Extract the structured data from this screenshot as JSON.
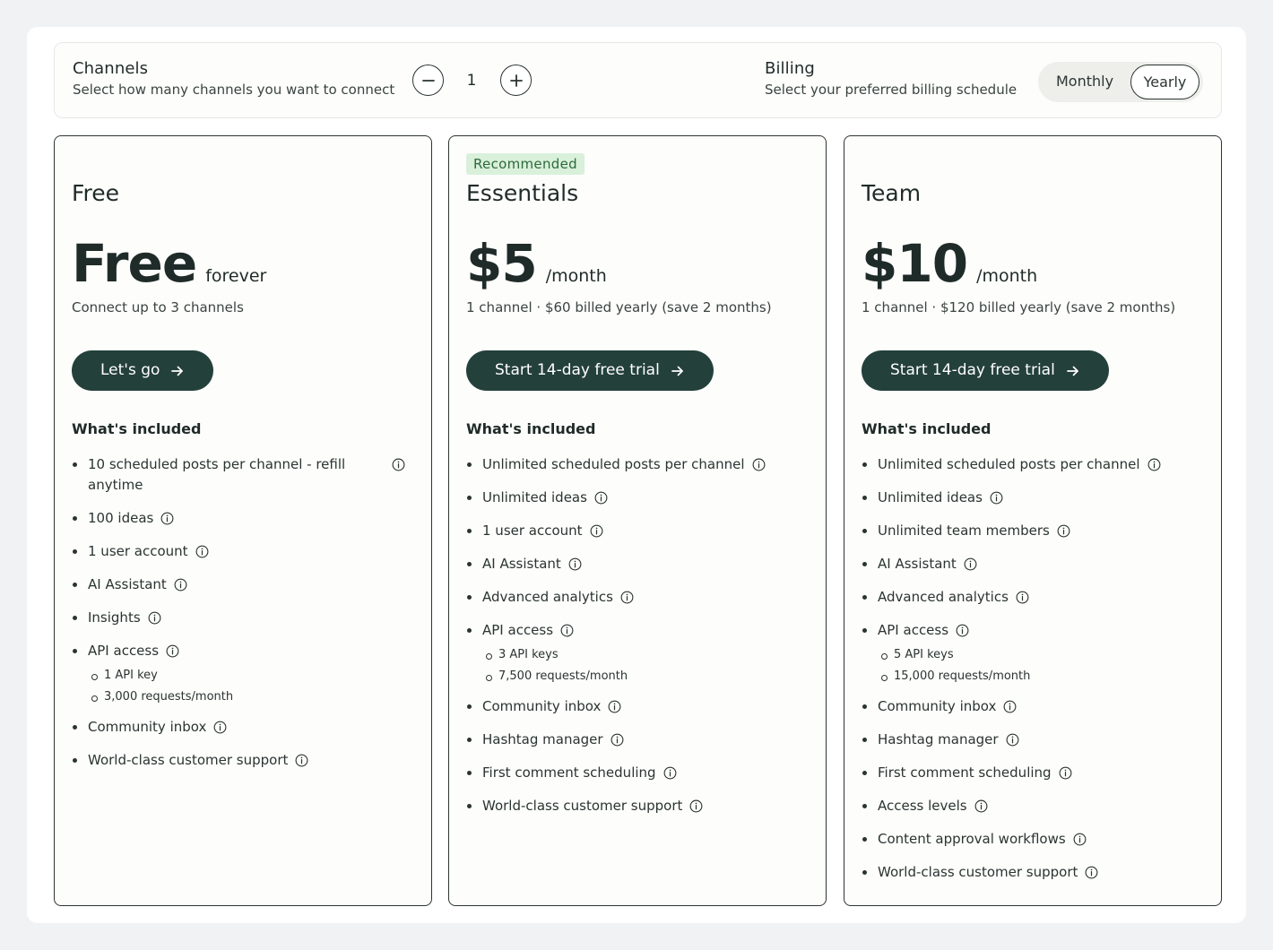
{
  "channels": {
    "title": "Channels",
    "subtitle": "Select how many channels you want to connect",
    "count": "1"
  },
  "billing": {
    "title": "Billing",
    "subtitle": "Select your preferred billing schedule",
    "options": [
      "Monthly",
      "Yearly"
    ],
    "selected": "Yearly"
  },
  "plans": [
    {
      "name": "Free",
      "price": "Free",
      "unit": "forever",
      "note": "Connect up to 3 channels",
      "cta": "Let's go",
      "included_heading": "What's included",
      "features": [
        "10 scheduled posts per channel - refill anytime",
        "100 ideas",
        "1 user account",
        "AI Assistant",
        "Insights",
        "API access",
        "Community inbox",
        "World-class customer support"
      ],
      "api_sub": [
        "1 API key",
        "3,000 requests/month"
      ]
    },
    {
      "badge": "Recommended",
      "name": "Essentials",
      "price": "$5",
      "unit": "/month",
      "note": "1 channel · $60 billed yearly (save 2 months)",
      "cta": "Start 14-day free trial",
      "included_heading": "What's included",
      "features": [
        "Unlimited scheduled posts per channel",
        "Unlimited ideas",
        "1 user account",
        "AI Assistant",
        "Advanced analytics",
        "API access",
        "Community inbox",
        "Hashtag manager",
        "First comment scheduling",
        "World-class customer support"
      ],
      "api_sub": [
        "3 API keys",
        "7,500 requests/month"
      ]
    },
    {
      "name": "Team",
      "price": "$10",
      "unit": "/month",
      "note": "1 channel · $120 billed yearly (save 2 months)",
      "cta": "Start 14-day free trial",
      "included_heading": "What's included",
      "features": [
        "Unlimited scheduled posts per channel",
        "Unlimited ideas",
        "Unlimited team members",
        "AI Assistant",
        "Advanced analytics",
        "API access",
        "Community inbox",
        "Hashtag manager",
        "First comment scheduling",
        "Access levels",
        "Content approval workflows",
        "World-class customer support"
      ],
      "api_sub": [
        "5 API keys",
        "15,000 requests/month"
      ]
    }
  ],
  "icons": {
    "info": "info-circle-icon",
    "arrow": "arrow-right-icon",
    "minus": "minus-icon",
    "plus": "plus-icon"
  },
  "colors": {
    "button": "#24403b",
    "badge_bg": "#d9f0da",
    "badge_text": "#2e6a3c"
  }
}
